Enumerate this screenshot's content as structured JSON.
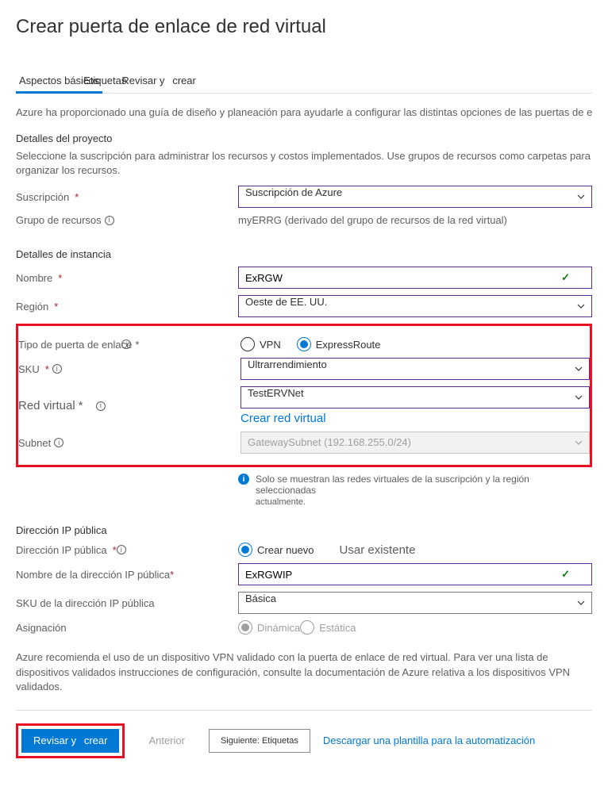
{
  "page_title": "Crear puerta de enlace de red virtual",
  "tabs": {
    "basics": "Aspectos básicos",
    "tags": "Etiquetas",
    "review_word": "Revisar y",
    "create_word": "crear"
  },
  "intro": "Azure ha proporcionado una guía de diseño y planeación para ayudarle a configurar las distintas opciones de las puertas de enlace de V",
  "project_details_h": "Detalles del proyecto",
  "project_details_desc": "Seleccione la suscripción para administrar los recursos y costos implementados. Use grupos de recursos como carpetas para organizar los recursos.",
  "subscription_label": "Suscripción",
  "subscription_value": "Suscripción de Azure",
  "rg_label": "Grupo de recursos",
  "rg_value": "myERRG (derivado del grupo de recursos de la red virtual)",
  "instance_h": "Detalles de instancia",
  "name_label": "Nombre",
  "name_value": "ExRGW",
  "region_label": "Región",
  "region_value": "Oeste de EE. UU.",
  "gwtype_label": "Tipo de puerta de enlace",
  "gwtype_vpn": "VPN",
  "gwtype_er": "ExpressRoute",
  "sku_label": "SKU",
  "sku_value": "Ultrarrendimiento",
  "vnet_label": "Red virtual",
  "vnet_value": "TestERVNet",
  "vnet_create_link": "Crear red virtual",
  "subnet_label": "Subnet",
  "subnet_value": "GatewaySubnet (192.168.255.0/24)",
  "info_vnet_line1": "Solo se muestran las redes virtuales de la suscripción y la región seleccionadas",
  "info_vnet_line2": "actualmente.",
  "pip_h": "Dirección IP pública",
  "pip_radio_label": "Dirección IP pública",
  "pip_radio_new": "Crear nuevo",
  "pip_radio_existing": "Usar existente",
  "pip_name_label": "Nombre de la dirección IP pública",
  "pip_name_value": "ExRGWIP",
  "pip_sku_label": "SKU de la dirección IP pública",
  "pip_sku_value": "Básica",
  "assign_label": "Asignación",
  "assign_dyn": "Dinámica",
  "assign_static": "Estática",
  "vpn_note": "Azure recomienda el uso de un dispositivo VPN validado con la puerta de enlace de red virtual. Para ver una lista de dispositivos validados instrucciones de configuración, consulte la documentación de Azure relativa a los dispositivos VPN validados.",
  "btn_review": "Revisar y",
  "btn_create": "crear",
  "btn_prev": "Anterior",
  "btn_next": "Siguiente: Etiquetas",
  "download_template": "Descargar una plantilla para la automatización"
}
